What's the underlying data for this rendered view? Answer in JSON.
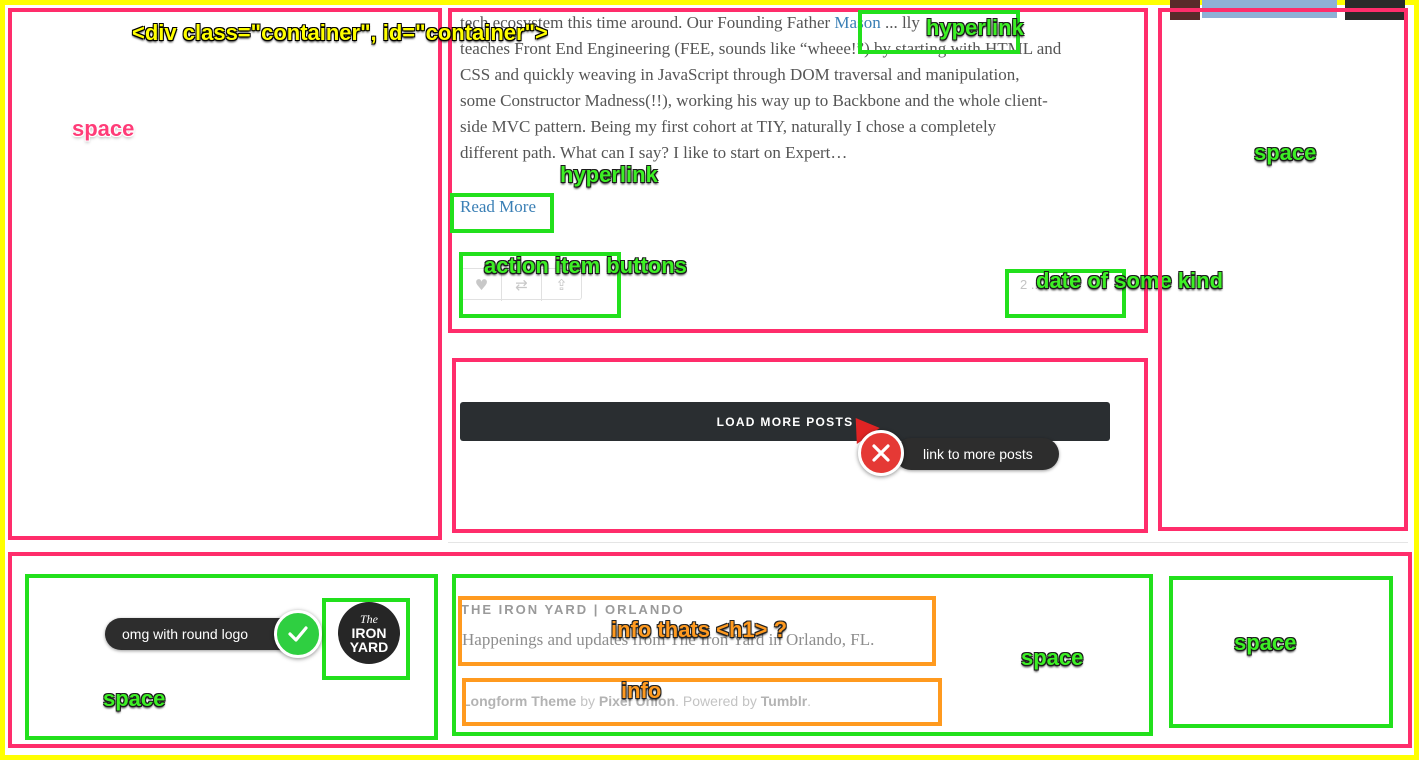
{
  "annotations": {
    "container_label": "<div class=\"container\", id=\"container\">",
    "space_left": "space",
    "hyperlink_top": "hyperlink",
    "hyperlink_read": "hyperlink",
    "action_items": "action item buttons",
    "date_label": "date of some kind",
    "space_right": "space",
    "footer_space_left": "space",
    "info_h1": "info thats <h1> ?",
    "info": "info",
    "footer_space_mid": "space",
    "footer_space_right": "space",
    "tooltip_logo": "omg with round logo",
    "tooltip_load": "link to more posts"
  },
  "post": {
    "line0": "tech ecosystem this time around. Our Founding Father ",
    "line0_link": "Mason",
    "line0_end": " ... lly",
    "line1": "teaches Front End Engineering (FEE, sounds like “wheee!”) by starting with HTML and",
    "line2": "CSS and quickly weaving in JavaScript through DOM traversal and manipulation,",
    "line3": "some Constructor Madness(!!), working his way up to Backbone and the whole client-",
    "line4": "side MVC pattern. Being my first cohort at TIY, naturally I chose a completely",
    "line5": "different path. What can I say? I like to start on Expert…",
    "read_more": "Read More",
    "date": "2 ..."
  },
  "actions": {
    "like": "♥",
    "reblog": "⇄",
    "share": "⇪"
  },
  "load_more": "LOAD MORE POSTS",
  "footer": {
    "title": "THE IRON YARD | ORLANDO",
    "description": "Happenings and updates from The Iron Yard in Orlando, FL.",
    "credit_theme": "Longform Theme",
    "credit_by": " by ",
    "credit_author": "Pixel Union",
    "credit_powered": ". Powered by ",
    "credit_platform": "Tumblr",
    "credit_end": "."
  },
  "logo": {
    "line1": "The",
    "line2": "IRON",
    "line3": "YARD"
  },
  "colors": {
    "yellow": "#ffff00",
    "pink": "#ff2d6b",
    "green": "#22e01c",
    "orange": "#ff9a1f",
    "button_dark": "#2a2e31",
    "link": "#3a7fb5"
  }
}
